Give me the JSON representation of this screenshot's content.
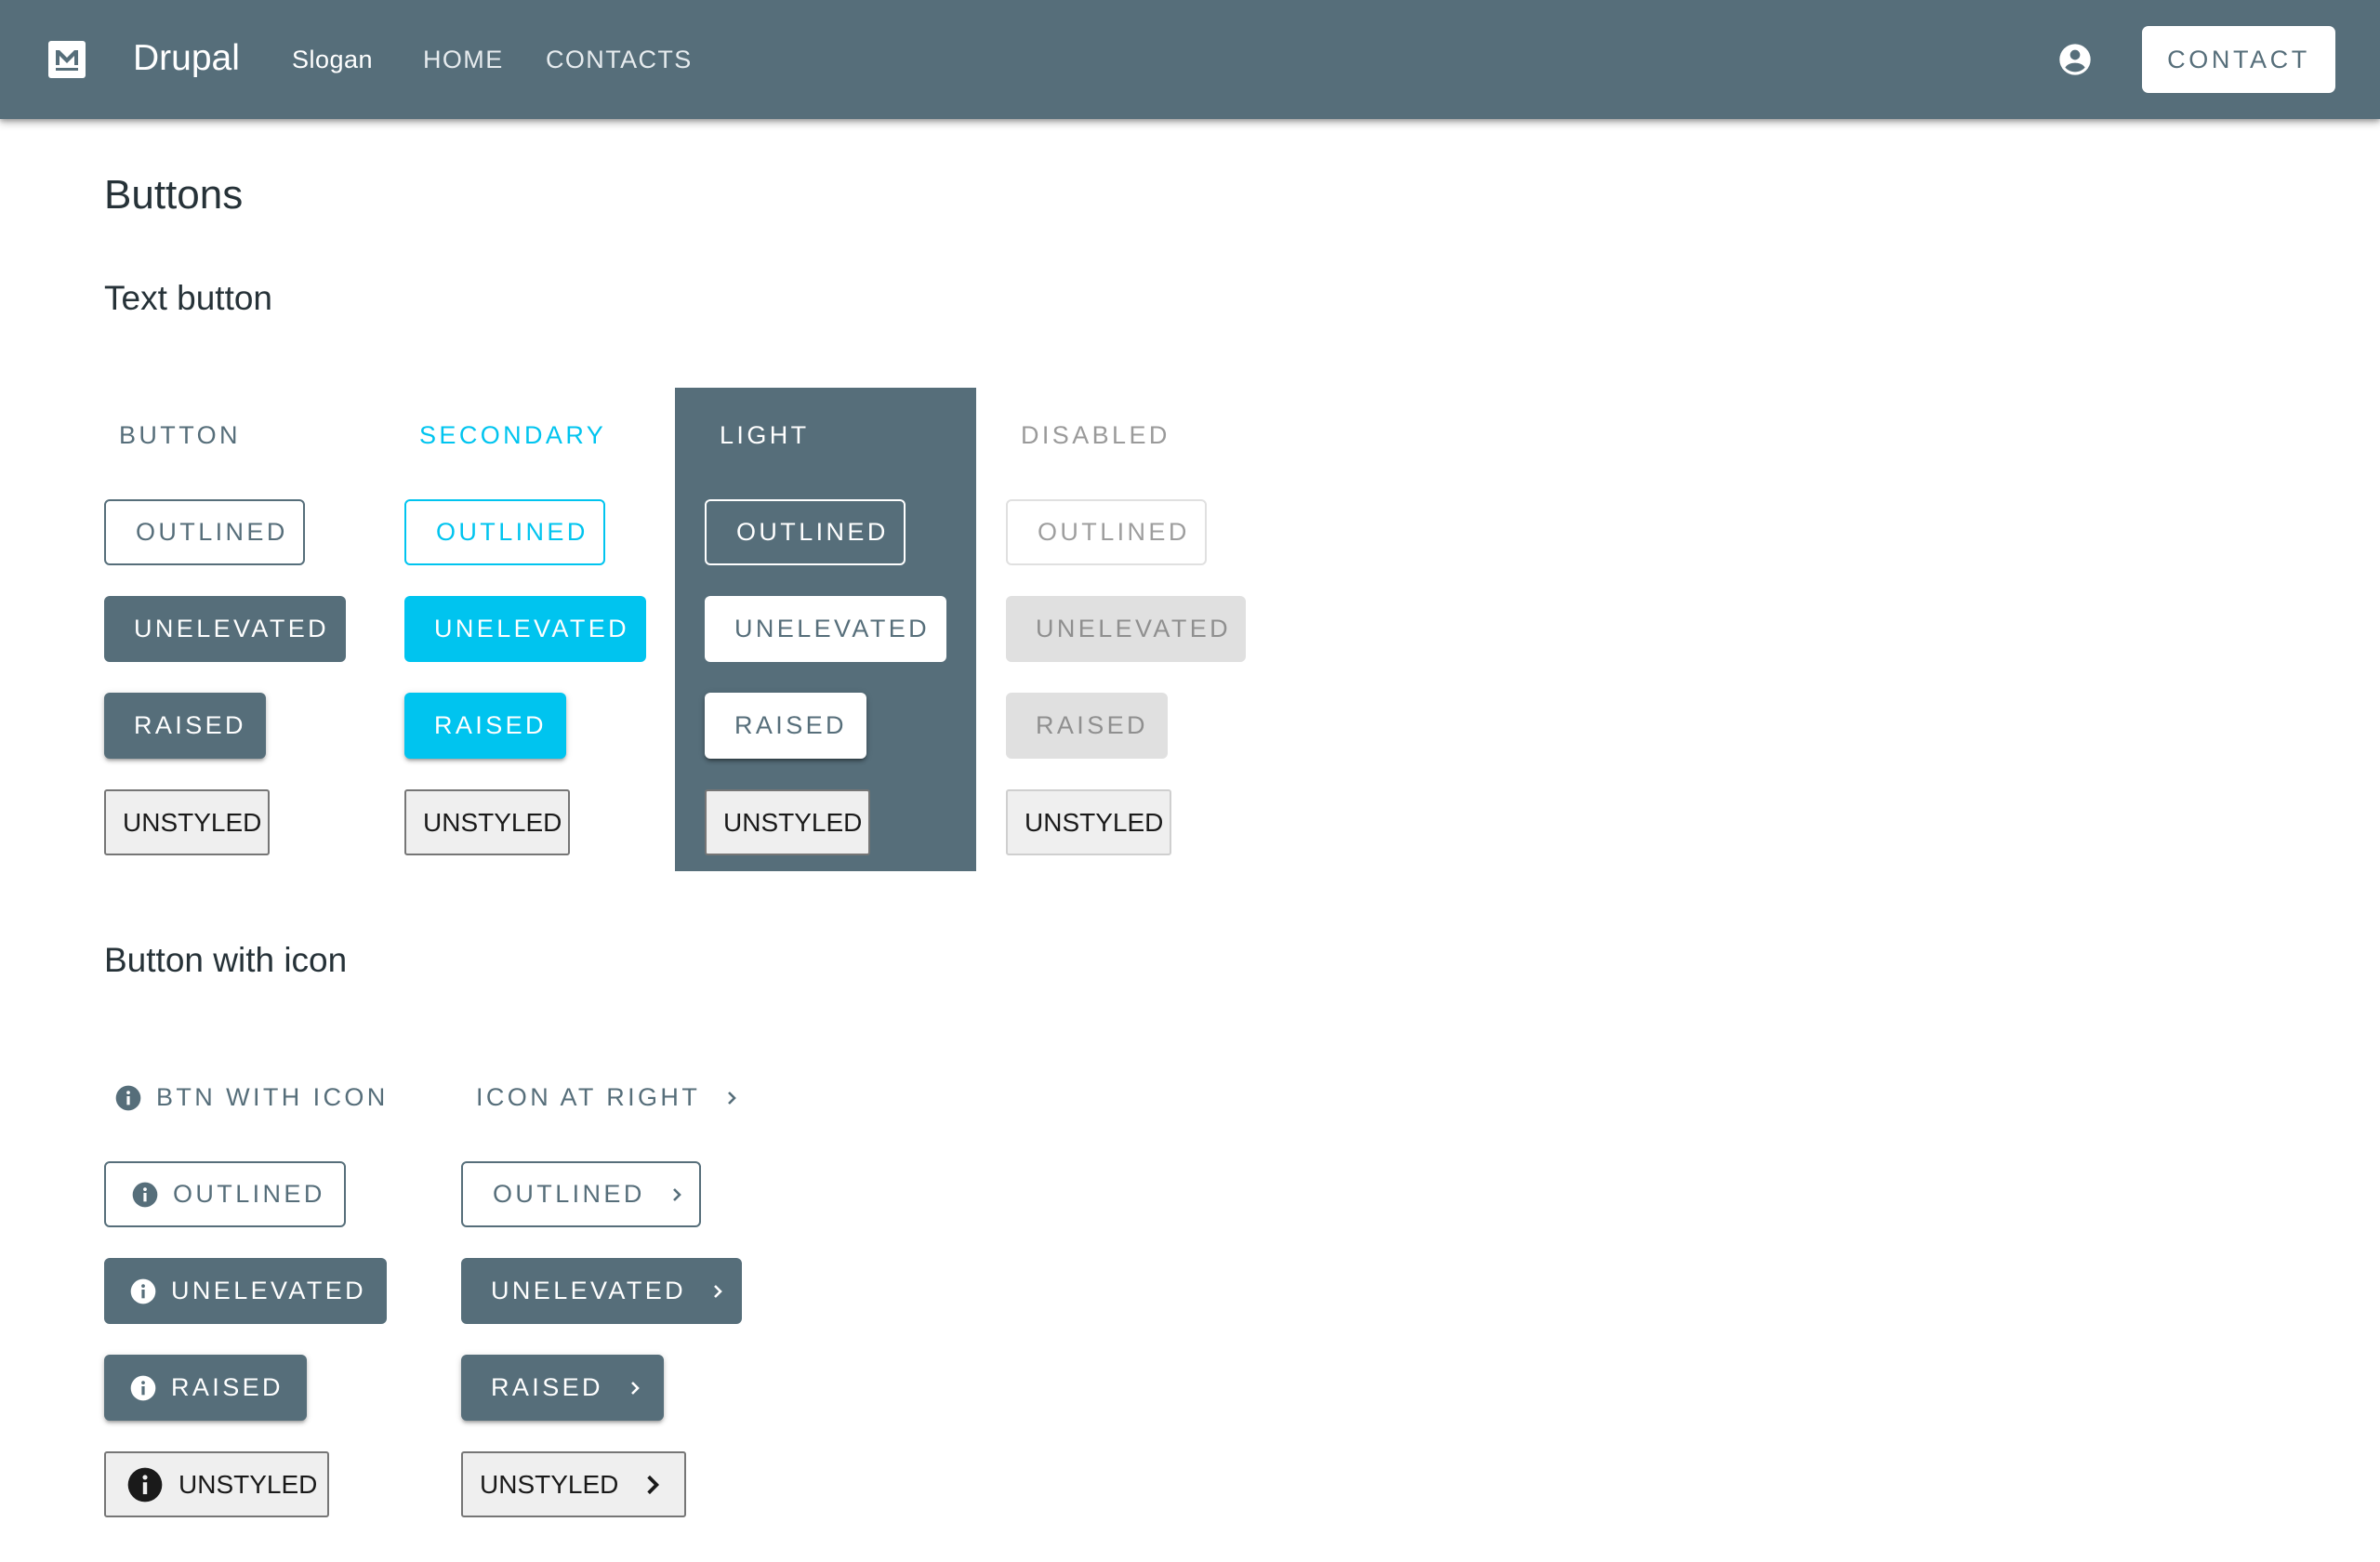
{
  "header": {
    "logo_icon": "material-logo-icon",
    "site_name": "Drupal",
    "slogan": "Slogan",
    "nav": [
      {
        "label": "HOME"
      },
      {
        "label": "CONTACTS"
      }
    ],
    "account_icon": "account-circle-icon",
    "contact_button": "CONTACT"
  },
  "page": {
    "title": "Buttons"
  },
  "text_button_section": {
    "title": "Text button",
    "columns": [
      {
        "variant": "primary",
        "header": "BUTTON",
        "outlined": "OUTLINED",
        "unelevated": "UNELEVATED",
        "raised": "RAISED",
        "unstyled": "UNSTYLED"
      },
      {
        "variant": "secondary",
        "header": "SECONDARY",
        "outlined": "OUTLINED",
        "unelevated": "UNELEVATED",
        "raised": "RAISED",
        "unstyled": "UNSTYLED"
      },
      {
        "variant": "light",
        "header": "LIGHT",
        "outlined": "OUTLINED",
        "unelevated": "UNELEVATED",
        "raised": "RAISED",
        "unstyled": "UNSTYLED"
      },
      {
        "variant": "disabled",
        "header": "DISABLED",
        "outlined": "OUTLINED",
        "unelevated": "UNELEVATED",
        "raised": "RAISED",
        "unstyled": "UNSTYLED"
      }
    ]
  },
  "icon_button_section": {
    "title": "Button with icon",
    "columns": [
      {
        "icon": "info-icon",
        "icon_position": "left",
        "header": "BTN WITH ICON",
        "outlined": "OUTLINED",
        "unelevated": "UNELEVATED",
        "raised": "RAISED",
        "unstyled": "UNSTYLED"
      },
      {
        "icon": "chevron-right-icon",
        "icon_position": "right",
        "header": "ICON AT RIGHT",
        "outlined": "OUTLINED",
        "unelevated": "UNELEVATED",
        "raised": "RAISED",
        "unstyled": "UNSTYLED"
      }
    ]
  },
  "colors": {
    "primary": "#566e7a",
    "secondary": "#00c4ef",
    "disabled_bg": "#e0e0e0",
    "disabled_text": "#9e9e9e",
    "unstyled_bg": "#efefef"
  }
}
